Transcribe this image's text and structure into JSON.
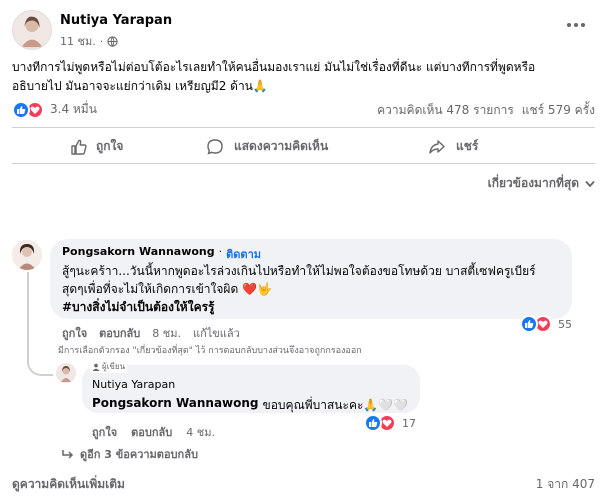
{
  "post": {
    "author": "Nutiya Yarapan",
    "time": "11 ชม.",
    "privacy_icon": "globe-icon",
    "text_line1": "บางทีการไม่พูดหรือไม่ต่อบโต้อะไรเลยทำให้คนอื่นมองเราแย่ มันไม่ใช่เรื่องที่ดีนะ แต่บางทีการที่พูดหรือ",
    "text_line2": "อธิบายไป มันอาจจะแย่กว่าเดิม เหรียญมี2 ด้าน🙏",
    "reaction_count": "3.4 หมื่น",
    "comments_count": "ความคิดเห็น 478 รายการ",
    "shares_count": "แชร์ 579 ครั้ง"
  },
  "actions": {
    "like": "ถูกใจ",
    "comment": "แสดงความคิดเห็น",
    "share": "แชร์"
  },
  "filter": {
    "label": "เกี่ยวข้องมากที่สุด"
  },
  "comment1": {
    "author": "Pongsakorn Wannawong",
    "follow": "ติดตาม",
    "line1": "สู้ๆนะคร้าา...วันนี้หากพูดอะไรล่วงเกินไปหรือทำให้ไม่พอใจต้องขอโทษด้วย บาสตี้เซฟครูเบียร์",
    "line2": "สุดๆเพื่อที่จะไม่ให้เกิดการเข้าใจผิด ❤️🤟",
    "hashtag": "#บางสิ่งไม่จำเป็นต้องให้ใครรู้",
    "like": "ถูกใจ",
    "reply": "ตอบกลับ",
    "time": "8 ชม.",
    "edited": "แก้ไขแล้ว",
    "reactions": "55",
    "filter_note": "มีการเลือกตัวกรอง \"เกี่ยวข้องที่สุด\" ไว้ การตอบกลับบางส่วนจึงอาจถูกกรองออก"
  },
  "reply1": {
    "badge": "ผู้เขียน",
    "author": "Nutiya Yarapan",
    "mention": "Pongsakorn Wannawong",
    "text": "ขอบคุณพี่บาสนะคะ🙏🤍🤍",
    "like": "ถูกใจ",
    "reply": "ตอบกลับ",
    "time": "4 ชม.",
    "reactions": "17"
  },
  "more_replies": "ดูอีก 3 ข้อความตอบกลับ",
  "footer": {
    "more_comments": "ดูความคิดเห็นเพิ่มเติม",
    "pagination": "1 จาก 407"
  },
  "colors": {
    "accent": "#1b74e4",
    "like_blue": "#1877f2",
    "love_red": "#f33e58",
    "muted": "#65676b",
    "bubble": "#f0f2f5"
  }
}
